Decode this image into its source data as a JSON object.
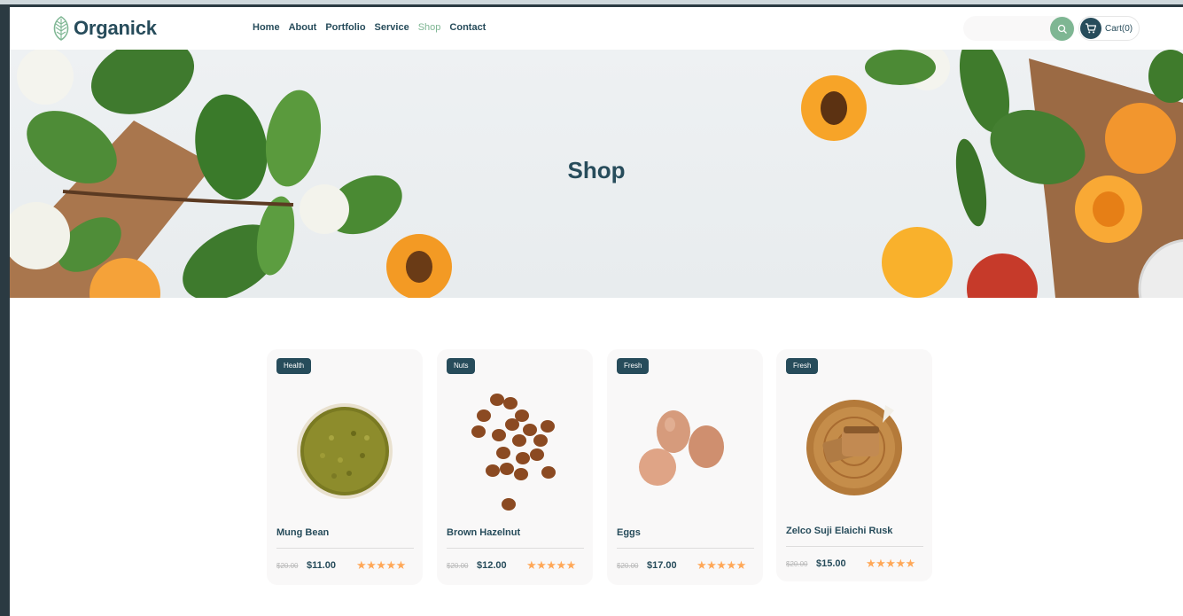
{
  "header": {
    "logo_text": "Organick",
    "nav": [
      "Home",
      "About",
      "Portfolio",
      "Service",
      "Shop",
      "Contact"
    ],
    "active_nav": "Shop",
    "search_placeholder": "",
    "cart_label": "Cart(0)"
  },
  "hero": {
    "title": "Shop"
  },
  "products": [
    {
      "badge": "Health",
      "name": "Mung Bean",
      "old_price": "$20.00",
      "price": "$11.00",
      "rating": 5,
      "image": "mung-bean-bowl"
    },
    {
      "badge": "Nuts",
      "name": "Brown Hazelnut",
      "old_price": "$20.00",
      "price": "$12.00",
      "rating": 5,
      "image": "hazelnuts"
    },
    {
      "badge": "Fresh",
      "name": "Eggs",
      "old_price": "$20.00",
      "price": "$17.00",
      "rating": 5,
      "image": "eggs"
    },
    {
      "badge": "Fresh",
      "name": "Zelco Suji Elaichi Rusk",
      "old_price": "$20.00",
      "price": "$15.00",
      "rating": 5,
      "image": "rusk-on-wood"
    }
  ],
  "colors": {
    "brand": "#274c5b",
    "accent": "#7eb693",
    "star": "#ffa858",
    "card_bg": "#f9f8f8"
  },
  "icons": [
    "leaf-logo-icon",
    "search-icon",
    "cart-icon",
    "star-icon"
  ]
}
